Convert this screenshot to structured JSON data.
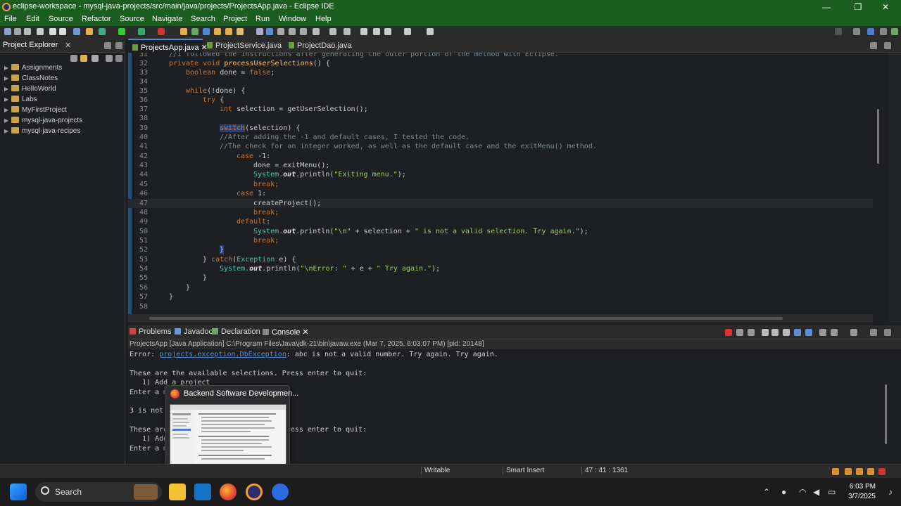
{
  "window": {
    "title": "eclipse-workspace - mysql-java-projects/src/main/java/projects/ProjectsApp.java - Eclipse IDE",
    "minimize": "—",
    "maximize": "❐",
    "close": "✕"
  },
  "menu": [
    "File",
    "Edit",
    "Source",
    "Refactor",
    "Source",
    "Navigate",
    "Search",
    "Project",
    "Run",
    "Window",
    "Help"
  ],
  "explorer": {
    "title": "Project Explorer",
    "close": "✕",
    "items": [
      "Assignments",
      "ClassNotes",
      "HelloWorld",
      "Labs",
      "MyFirstProject",
      "mysql-java-projects",
      "mysql-java-recipes"
    ]
  },
  "editor": {
    "tabs": [
      {
        "label": "ProjectsApp.java",
        "close": "✕"
      },
      {
        "label": "ProjectService.java"
      },
      {
        "label": "ProjectDao.java"
      }
    ],
    "line_numbers": [
      "31",
      "32",
      "33",
      "34",
      "35",
      "36",
      "37",
      "38",
      "39",
      "40",
      "41",
      "42",
      "43",
      "44",
      "45",
      "46",
      "47",
      "48",
      "49",
      "50",
      "51",
      "52",
      "53",
      "54",
      "55",
      "56",
      "57",
      "58"
    ],
    "l31": "//I followed the instructions after generating the outer portion of the method with Eclipse.",
    "l32_kw1": "private",
    "l32_kw2": "void",
    "l32_fn": "processUserSelections",
    "l32_rest": "() {",
    "l33_kw": "boolean",
    "l33_var": "done",
    "l33_eq": " = ",
    "l33_val": "false",
    "l33_end": ";",
    "l35_kw": "while",
    "l35_rest": "(!done) {",
    "l36_kw": "try",
    "l36_rest": " {",
    "l37_kw": "int",
    "l37_rest": " selection = getUserSelection();",
    "l39_kw": "switch",
    "l39_rest": "(selection) {",
    "l40": "//After adding the -1 and default cases, I tested the code.",
    "l41": "//The check for an integer worked, as well as the default case and the exitMenu() method.",
    "l42_kw": "case",
    "l42_rest": " -1:",
    "l43": "done = exitMenu();",
    "l44_sys": "System.",
    "l44_out": "out",
    "l44_call": ".println(",
    "l44_str": "\"Exiting menu.\"",
    "l44_end": ");",
    "l45": "break;",
    "l46_kw": "case",
    "l46_rest": " 1:",
    "l47": "createProject();",
    "l48": "break;",
    "l49_kw": "default",
    "l49_rest": ":",
    "l50_sys": "System.",
    "l50_out": "out",
    "l50_call": ".println(",
    "l50_str1": "\"\\n\"",
    "l50_mid": " + selection + ",
    "l50_str2": "\" is not a valid selection. Try again.\"",
    "l50_end": ");",
    "l51": "break;",
    "l52": "}",
    "l53_pre": "} ",
    "l53_kw": "catch",
    "l53_p": "(",
    "l53_ty": "Exception",
    "l53_rest": " e) {",
    "l54_sys": "System.",
    "l54_out": "out",
    "l54_call": ".println(",
    "l54_str1": "\"\\nError: \"",
    "l54_mid": " + e + ",
    "l54_str2": "\" Try again.\"",
    "l54_end": ");",
    "l55": "}",
    "l56": "}",
    "l57": "}"
  },
  "bottom": {
    "tabs": [
      "Problems",
      "Javadoc",
      "Declaration",
      "Console"
    ],
    "console_close": "✕",
    "description": "ProjectsApp [Java Application] C:\\Program Files\\Java\\jdk-21\\bin\\javaw.exe  (Mar 7, 2025, 6:03:07 PM) [pid: 20148]",
    "lines": {
      "c1_pre": "Error: ",
      "c1_link": "projects.exception.DbException",
      "c1_post": ": abc is not a valid number. Try again. Try again.",
      "c2": "These are the available selections. Press enter to quit:",
      "c3": "   1) Add a project",
      "c4": "Enter a menu selection: 3",
      "c5": "3 is not a valid selection. Try again.",
      "c6": "These are the available selections. Press enter to quit:",
      "c7": "   1) Add a project",
      "c8": "Enter a menu selection: "
    }
  },
  "status": {
    "mode": "Writable",
    "insert": "Smart Insert",
    "position": "47 : 41 : 1361"
  },
  "preview": {
    "title": "Backend Software Developmen..."
  },
  "taskbar": {
    "search": "Search",
    "time": "6:03 PM",
    "date": "3/7/2025"
  }
}
